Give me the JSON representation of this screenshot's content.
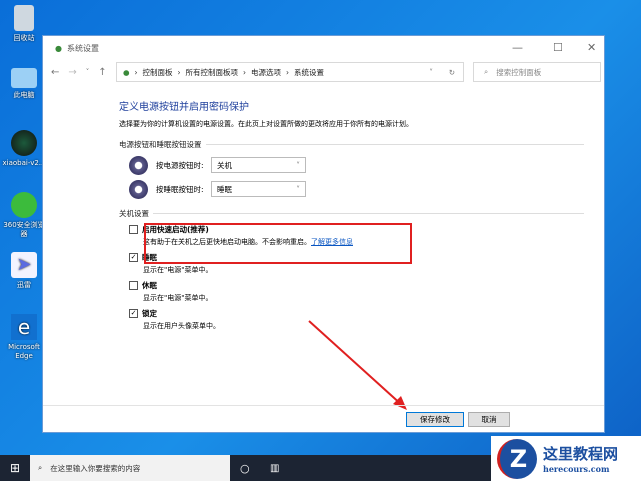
{
  "desktop": [
    {
      "label": "回收站"
    },
    {
      "label": "此电脑"
    },
    {
      "label": "xiaobai-v2..."
    },
    {
      "label": "360安全浏览器"
    },
    {
      "label": "迅雷"
    },
    {
      "label": "Microsoft Edge"
    }
  ],
  "window": {
    "title": "系统设置",
    "breadcrumbs": [
      "控制面板",
      "所有控制面板项",
      "电源选项",
      "系统设置"
    ],
    "search_placeholder": "搜索控制面板"
  },
  "page": {
    "heading": "定义电源按钮并启用密码保护",
    "subtitle": "选择要为你的计算机设置的电源设置。在此页上对设置所做的更改将应用于你所有的电源计划。",
    "section1": "电源按钮和睡眠按钮设置",
    "power_label": "按电源按钮时:",
    "power_value": "关机",
    "sleep_label": "按睡眠按钮时:",
    "sleep_value": "睡眠",
    "section2": "关机设置",
    "options": [
      {
        "label": "启用快速启动(推荐)",
        "checked": false,
        "desc": "这有助于在关机之后更快地启动电脑。不会影响重启。",
        "link": "了解更多信息"
      },
      {
        "label": "睡眠",
        "checked": true,
        "desc": "显示在\"电源\"菜单中。"
      },
      {
        "label": "休眠",
        "checked": false,
        "desc": "显示在\"电源\"菜单中。"
      },
      {
        "label": "锁定",
        "checked": true,
        "desc": "显示在用户头像菜单中。"
      }
    ],
    "save": "保存修改",
    "cancel": "取消"
  },
  "taskbar": {
    "search_placeholder": "在这里输入你要搜索的内容"
  },
  "watermark": {
    "title": "这里教程网",
    "url": "herecours.com"
  },
  "colors": {
    "highlight": "#e02020",
    "heading": "#1e3f9c",
    "link": "#0a56c2"
  }
}
